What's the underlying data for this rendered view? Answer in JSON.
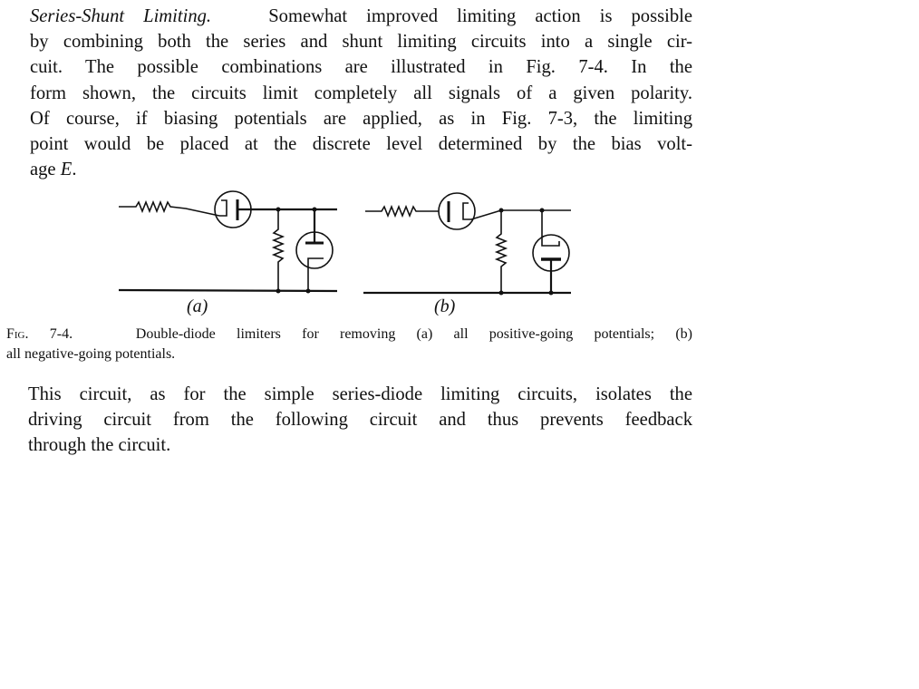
{
  "paragraph1": {
    "heading": "Series-Shunt Limiting.",
    "lines": [
      "Somewhat improved limiting action is possible",
      "by combining both the series and shunt limiting circuits into a single cir-",
      "cuit.  The possible combinations are illustrated in Fig. 7-4.  In the",
      "form shown, the circuits limit completely all signals of a given polarity.",
      "Of course, if biasing potentials are applied, as in Fig. 7-3, the limiting",
      "point would be placed at the discrete level determined by the bias volt-",
      "age "
    ],
    "last_italic": "E",
    "last_end": "."
  },
  "figure": {
    "label_a": "(a)",
    "label_b": "(b)",
    "caption": {
      "fig_label": "Fig. 7-4.",
      "line1": "Double-diode limiters for removing (a) all positive-going potentials; (b)",
      "line2": "all negative-going potentials."
    }
  },
  "paragraph2": {
    "lines": [
      "This circuit, as for the simple series-diode limiting circuits, isolates the",
      "driving circuit from the following circuit and thus prevents feedback",
      "through the circuit."
    ]
  }
}
